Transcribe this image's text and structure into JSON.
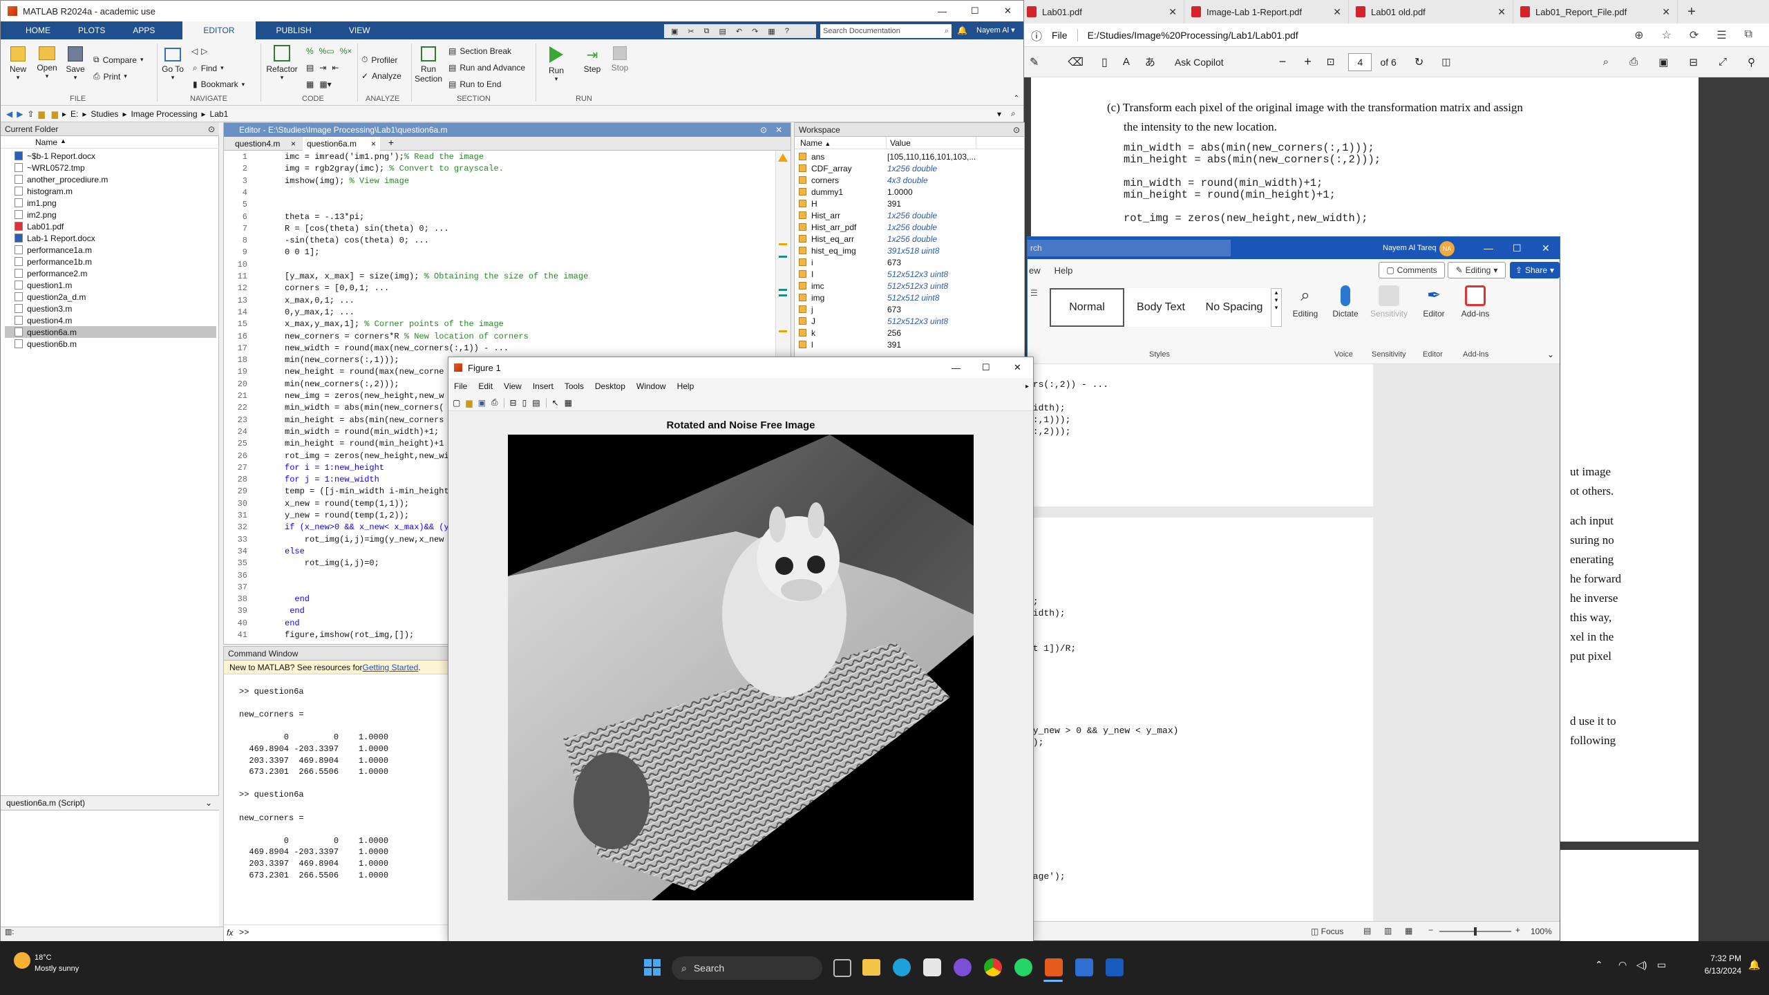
{
  "edge": {
    "tabs": [
      "Lab01.pdf",
      "Image-Lab 1-Report.pdf",
      "Lab01 old.pdf",
      "Lab01_Report_File.pdf"
    ],
    "new_tab": "+",
    "file_label": "File",
    "url": "E:/Studies/Image%20Processing/Lab1/Lab01.pdf",
    "ask_copilot": "Ask Copilot",
    "page_current": "4",
    "page_total": "of 6",
    "pdf_para": [
      "(c) Transform each pixel of the original image with the transformation matrix and assign",
      "the intensity to the new location."
    ],
    "pdf_code": [
      "min_width = abs(min(new_corners(:,1)));",
      "min_height = abs(min(new_corners(:,2)));",
      "",
      "min_width = round(min_width)+1;",
      "min_height = round(min_height)+1;",
      "",
      "rot_img = zeros(new_height,new_width);"
    ],
    "pdf_right_fragments": [
      "ut image",
      "ot others.",
      "ach input",
      "suring no",
      "enerating",
      "he forward",
      "he inverse",
      " this way,",
      "xel in the",
      "put pixel",
      "d use it to",
      "following"
    ]
  },
  "word": {
    "search_placeholder": "rch",
    "user": "Nayem Al Tareq",
    "avatar_initials": "NA",
    "menu": [
      "ew",
      "Help"
    ],
    "comments": "Comments",
    "editing_mode": "Editing",
    "share": "Share",
    "styles": [
      "Normal",
      "Body Text",
      "No Spacing"
    ],
    "buttons": [
      "Editing",
      "Dictate",
      "Sensitivity",
      "Editor",
      "Add-ins"
    ],
    "groups": [
      "Styles",
      "Voice",
      "Sensitivity",
      "Editor",
      "Add-ins"
    ],
    "code_fragments": [
      "ers(:,2)) - ...",
      "width);",
      "(:,1)));",
      "(:,2)));",
      "1;",
      "width);",
      "nt 1])/R;",
      "(y_new > 0 && y_new < y_max)",
      "g);",
      "mage');"
    ],
    "focus": "Focus",
    "zoom": "100%"
  },
  "matlab": {
    "title": "MATLAB R2024a - academic use",
    "tabs": [
      "HOME",
      "PLOTS",
      "APPS",
      "EDITOR",
      "PUBLISH",
      "VIEW"
    ],
    "active_tab": "EDITOR",
    "search_placeholder": "Search Documentation",
    "user": "Nayem Al",
    "toolstrip": {
      "new": "New",
      "open": "Open",
      "save": "Save",
      "compare": "Compare",
      "print": "Print",
      "goto": "Go To",
      "find": "Find",
      "bookmark": "Bookmark",
      "refactor": "Refactor",
      "profiler": "Profiler",
      "analyze": "Analyze",
      "run_section": "Run\nSection",
      "section_break": "Section Break",
      "run_advance": "Run and Advance",
      "run_to_end": "Run to End",
      "run": "Run",
      "step": "Step",
      "stop": "Stop",
      "groups": [
        "FILE",
        "NAVIGATE",
        "CODE",
        "ANALYZE",
        "SECTION",
        "RUN"
      ]
    },
    "path": [
      "E:",
      "Studies",
      "Image Processing",
      "Lab1"
    ],
    "current_folder": {
      "header": "Current Folder",
      "col_name": "Name",
      "files": [
        "~$b-1 Report.docx",
        "~WRL0572.tmp",
        "another_procediure.m",
        "histogram.m",
        "im1.png",
        "im2.png",
        "Lab01.pdf",
        "Lab-1 Report.docx",
        "performance1a.m",
        "performance1b.m",
        "performance2.m",
        "question1.m",
        "question2a_d.m",
        "question3.m",
        "question4.m",
        "question6a.m",
        "question6b.m"
      ],
      "selected": "question6a.m",
      "detail": "question6a.m  (Script)"
    },
    "editor": {
      "header": "Editor - E:\\Studies\\Image Processing\\Lab1\\question6a.m",
      "tabs": [
        "question4.m",
        "question6a.m"
      ],
      "lines": [
        "imc = imread('im1.png');% Read the image",
        "img = rgb2gray(imc); % Convert to grayscale.",
        "imshow(img); % View image",
        "",
        "",
        "theta = -.13*pi;",
        "R = [cos(theta) sin(theta) 0; ...",
        "-sin(theta) cos(theta) 0; ...",
        "0 0 1];",
        "",
        "[y_max, x_max] = size(img); % Obtaining the size of the image",
        "corners = [0,0,1; ...",
        "x_max,0,1; ...",
        "0,y_max,1; ...",
        "x_max,y_max,1]; % Corner points of the image",
        "new_corners = corners*R % New location of corners",
        "new_width = round(max(new_corners(:,1)) - ...",
        "min(new_corners(:,1)));",
        "new_height = round(max(new_corne",
        "min(new_corners(:,2)));",
        "new_img = zeros(new_height,new_w",
        "min_width = abs(min(new_corners(",
        "min_height = abs(min(new_corners",
        "min_width = round(min_width)+1;",
        "min_height = round(min_height)+1",
        "rot_img = zeros(new_height,new_wi",
        "for i = 1:new_height",
        "for j = 1:new_width",
        "temp = ([j-min_width i-min_height",
        "x_new = round(temp(1,1));",
        "y_new = round(temp(1,2));",
        "if (x_new>0 && x_new< x_max)&& (y",
        "    rot_img(i,j)=img(y_new,x_new",
        "else",
        "    rot_img(i,j)=0;",
        "",
        "",
        "  end",
        " end",
        "end",
        "figure,imshow(rot_img,[]);"
      ]
    },
    "workspace": {
      "header": "Workspace",
      "col_name": "Name",
      "col_value": "Value",
      "vars": [
        {
          "name": "ans",
          "value": "[105,110,116,101,103,..."
        },
        {
          "name": "CDF_array",
          "value": "1x256 double"
        },
        {
          "name": "corners",
          "value": "4x3 double"
        },
        {
          "name": "dummy1",
          "value": "1.0000"
        },
        {
          "name": "H",
          "value": "391"
        },
        {
          "name": "Hist_arr",
          "value": "1x256 double"
        },
        {
          "name": "Hist_arr_pdf",
          "value": "1x256 double"
        },
        {
          "name": "Hist_eq_arr",
          "value": "1x256 double"
        },
        {
          "name": "hist_eq_img",
          "value": "391x518 uint8"
        },
        {
          "name": "i",
          "value": "673"
        },
        {
          "name": "I",
          "value": "512x512x3 uint8"
        },
        {
          "name": "imc",
          "value": "512x512x3 uint8"
        },
        {
          "name": "img",
          "value": "512x512 uint8"
        },
        {
          "name": "j",
          "value": "673"
        },
        {
          "name": "J",
          "value": "512x512x3 uint8"
        },
        {
          "name": "k",
          "value": "256"
        },
        {
          "name": "l",
          "value": "391"
        }
      ]
    },
    "command_window": {
      "header": "Command Window",
      "banner": "New to MATLAB? See resources for ",
      "banner_link": "Getting Started",
      "banner_end": ".",
      "lines": [
        ">> question6a",
        "",
        "new_corners =",
        "",
        "         0         0    1.0000",
        "  469.8904 -203.3397    1.0000",
        "  203.3397  469.8904    1.0000",
        "  673.2301  266.5506    1.0000",
        "",
        ">> question6a",
        "",
        "new_corners =",
        "",
        "         0         0    1.0000",
        "  469.8904 -203.3397    1.0000",
        "  203.3397  469.8904    1.0000",
        "  673.2301  266.5506    1.0000"
      ],
      "prompt": ">>",
      "fx": "fx"
    }
  },
  "figure": {
    "title": "Figure 1",
    "menu": [
      "File",
      "Edit",
      "View",
      "Insert",
      "Tools",
      "Desktop",
      "Window",
      "Help"
    ],
    "axes_title": "Rotated and Noise Free Image"
  },
  "taskbar": {
    "temp": "18°C",
    "weather": "Mostly sunny",
    "search": "Search",
    "time": "7:32 PM",
    "date": "6/13/2024"
  }
}
